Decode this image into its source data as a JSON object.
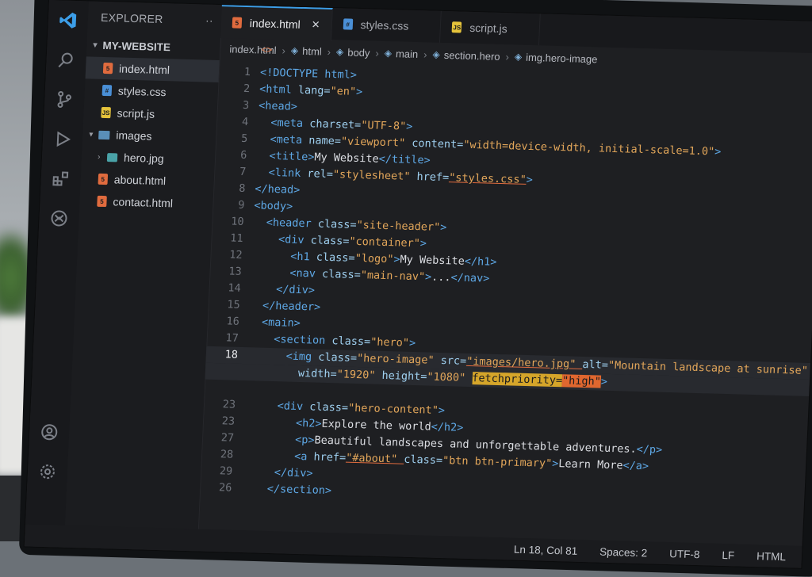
{
  "sidebar": {
    "title": "EXPLORER",
    "more": "··",
    "folder": "MY-WEBSITE",
    "items": [
      {
        "label": "index.html",
        "type": "html"
      },
      {
        "label": "styles.css",
        "type": "css"
      },
      {
        "label": "script.js",
        "type": "js"
      },
      {
        "label": "images",
        "type": "folder"
      },
      {
        "label": "hero.jpg",
        "type": "img"
      },
      {
        "label": "about.html",
        "type": "html"
      },
      {
        "label": "contact.html",
        "type": "html"
      }
    ]
  },
  "tabs": [
    {
      "label": "index.html",
      "icon_text": "5"
    },
    {
      "label": "styles.css",
      "icon_text": "#"
    },
    {
      "label": "script.js",
      "icon_text": "JS"
    }
  ],
  "tab_close": "✕",
  "breadcrumb": [
    "index.html",
    "html",
    "body",
    "main",
    "section.hero",
    "img.hero-image"
  ],
  "editor": {
    "lines": [
      {
        "n": "1",
        "segs": [
          [
            "tg",
            "<!DOCTYPE html>"
          ]
        ]
      },
      {
        "n": "2",
        "segs": [
          [
            "tg",
            "<html "
          ],
          [
            "at",
            "lang="
          ],
          [
            "st",
            "\"en\""
          ],
          [
            "tg",
            ">"
          ]
        ]
      },
      {
        "n": "3",
        "segs": [
          [
            "tg",
            "<head>"
          ]
        ]
      },
      {
        "n": "4",
        "segs": [
          [
            "sp",
            "  "
          ],
          [
            "tg",
            "<meta "
          ],
          [
            "at",
            "charset="
          ],
          [
            "st",
            "\"UTF-8\""
          ],
          [
            "tg",
            ">"
          ]
        ]
      },
      {
        "n": "5",
        "segs": [
          [
            "sp",
            "  "
          ],
          [
            "tg",
            "<meta "
          ],
          [
            "at",
            "name="
          ],
          [
            "st",
            "\"viewport\" "
          ],
          [
            "at",
            "content="
          ],
          [
            "st",
            "\"width=device-width, initial-scale=1.0\""
          ],
          [
            "tg",
            ">"
          ]
        ]
      },
      {
        "n": "6",
        "segs": [
          [
            "sp",
            "  "
          ],
          [
            "tg",
            "<title>"
          ],
          [
            "tx",
            "My Website"
          ],
          [
            "tg",
            "</title>"
          ]
        ]
      },
      {
        "n": "7",
        "segs": [
          [
            "sp",
            "  "
          ],
          [
            "tg",
            "<link "
          ],
          [
            "at",
            "rel="
          ],
          [
            "st",
            "\"stylesheet\" "
          ],
          [
            "at",
            "href="
          ],
          [
            "ul",
            "\"styles.css\""
          ],
          [
            "tg",
            ">"
          ]
        ]
      },
      {
        "n": "8",
        "segs": [
          [
            "tg",
            "</head>"
          ]
        ]
      },
      {
        "n": "9",
        "segs": [
          [
            "tg",
            "<body>"
          ]
        ]
      },
      {
        "n": "10",
        "segs": [
          [
            "sp",
            "  "
          ],
          [
            "tg",
            "<header "
          ],
          [
            "at",
            "class="
          ],
          [
            "st",
            "\"site-header\""
          ],
          [
            "tg",
            ">"
          ]
        ]
      },
      {
        "n": "11",
        "segs": [
          [
            "sp",
            "    "
          ],
          [
            "tg",
            "<div "
          ],
          [
            "at",
            "class="
          ],
          [
            "st",
            "\"container\""
          ],
          [
            "tg",
            ">"
          ]
        ]
      },
      {
        "n": "12",
        "segs": [
          [
            "sp",
            "      "
          ],
          [
            "tg",
            "<h1 "
          ],
          [
            "at",
            "class="
          ],
          [
            "st",
            "\"logo\""
          ],
          [
            "tg",
            ">"
          ],
          [
            "tx",
            "My Website"
          ],
          [
            "tg",
            "</h1>"
          ]
        ]
      },
      {
        "n": "13",
        "segs": [
          [
            "sp",
            "      "
          ],
          [
            "tg",
            "<nav "
          ],
          [
            "at",
            "class="
          ],
          [
            "st",
            "\"main-nav\""
          ],
          [
            "tg",
            ">"
          ],
          [
            "tx",
            "..."
          ],
          [
            "tg",
            "</nav>"
          ]
        ]
      },
      {
        "n": "14",
        "segs": [
          [
            "sp",
            "    "
          ],
          [
            "tg",
            "</div>"
          ]
        ]
      },
      {
        "n": "15",
        "segs": [
          [
            "sp",
            "  "
          ],
          [
            "tg",
            "</header>"
          ]
        ]
      },
      {
        "n": "16",
        "segs": [
          [
            "sp",
            "  "
          ],
          [
            "tg",
            "<main>"
          ]
        ]
      },
      {
        "n": "17",
        "segs": [
          [
            "sp",
            "    "
          ],
          [
            "tg",
            "<section "
          ],
          [
            "at",
            "class="
          ],
          [
            "st",
            "\"hero\""
          ],
          [
            "tg",
            ">"
          ]
        ]
      },
      {
        "n": "18",
        "cur": true,
        "segs": [
          [
            "sp",
            "      "
          ],
          [
            "tg",
            "<img "
          ],
          [
            "at",
            "class="
          ],
          [
            "st",
            "\"hero-image\" "
          ],
          [
            "at",
            "src="
          ],
          [
            "ul",
            "\"images/hero.jpg\" "
          ],
          [
            "at",
            "alt="
          ],
          [
            "st",
            "\"Mountain landscape at sunrise\""
          ]
        ]
      },
      {
        "n": "",
        "cur": true,
        "segs": [
          [
            "sp",
            "        "
          ],
          [
            "at",
            "width="
          ],
          [
            "st",
            "\"1920\" "
          ],
          [
            "at",
            "height="
          ],
          [
            "st",
            "\"1080\" "
          ],
          [
            "flag",
            "fetchpriority="
          ],
          [
            "flag2",
            "\"high\""
          ],
          [
            "flag",
            "​"
          ],
          [
            "tg",
            ">"
          ]
        ]
      },
      {
        "n": "",
        "segs": []
      },
      {
        "n": "23",
        "segs": [
          [
            "sp",
            "     "
          ],
          [
            "tg",
            "<div "
          ],
          [
            "at",
            "class="
          ],
          [
            "st",
            "\"hero-content\""
          ],
          [
            "tg",
            ">"
          ]
        ]
      },
      {
        "n": "23",
        "segs": [
          [
            "sp",
            "        "
          ],
          [
            "tg",
            "<h2>"
          ],
          [
            "tx",
            "Explore the world"
          ],
          [
            "tg",
            "</h2>"
          ]
        ]
      },
      {
        "n": "27",
        "segs": [
          [
            "sp",
            "        "
          ],
          [
            "tg",
            "<p>"
          ],
          [
            "tx",
            "Beautiful landscapes and unforgettable adventures."
          ],
          [
            "tg",
            "</p>"
          ]
        ]
      },
      {
        "n": "28",
        "segs": [
          [
            "sp",
            "        "
          ],
          [
            "tg",
            "<a "
          ],
          [
            "at",
            "href="
          ],
          [
            "ul",
            "\"#about\" "
          ],
          [
            "at",
            "class="
          ],
          [
            "st",
            "\"btn btn-primary\""
          ],
          [
            "tg",
            ">"
          ],
          [
            "tx",
            "Learn More"
          ],
          [
            "tg",
            "</a>"
          ]
        ]
      },
      {
        "n": "29",
        "segs": [
          [
            "sp",
            "     "
          ],
          [
            "tg",
            "</div>"
          ]
        ]
      },
      {
        "n": "26",
        "segs": [
          [
            "sp",
            "    "
          ],
          [
            "tg",
            "</section>"
          ]
        ]
      }
    ]
  },
  "status": {
    "position": "Ln 18, Col 81",
    "spaces": "Spaces: 2",
    "encoding": "UTF-8",
    "eol": "LF",
    "language": "HTML"
  }
}
